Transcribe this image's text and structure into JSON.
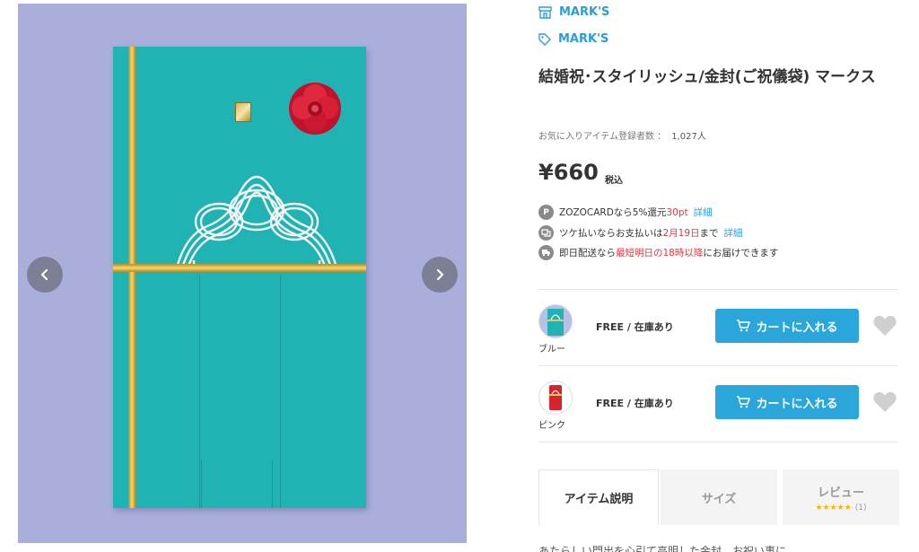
{
  "brand": {
    "shop_name": "MARK'S",
    "brand_name": "MARK'S"
  },
  "product": {
    "title": "結婚祝･スタイリッシュ/金封(ご祝儀袋) マークス",
    "favorite_label": "お気に入りアイテム登録者数 ：",
    "favorite_count": "1,027人",
    "price": "¥660",
    "tax_label": "税込"
  },
  "benefits": {
    "zozocard_prefix": "ZOZOCARDなら5%還元",
    "zozocard_points": "30pt",
    "zozocard_link": "詳細",
    "tsuke_prefix": "ツケ払いならお支払いは",
    "tsuke_date": "2月19日",
    "tsuke_suffix": "まで",
    "tsuke_link": "詳細",
    "delivery_prefix": "即日配送なら",
    "delivery_highlight": "最短明日の18時以降",
    "delivery_suffix": "にお届けできます"
  },
  "variants": [
    {
      "color": "ブルー",
      "stock": "FREE / 在庫あり",
      "cart_label": "カートに入れる",
      "swatch_color": "#1fb3b4"
    },
    {
      "color": "ピンク",
      "stock": "FREE / 在庫あり",
      "cart_label": "カートに入れる",
      "swatch_color": "#d8232e"
    }
  ],
  "tabs": {
    "description": "アイテム説明",
    "size": "サイズ",
    "review": "レビュー",
    "review_stars": "★★★★★",
    "review_count": "(1)"
  },
  "truncated_text": "あたらしい門出を心引て高明した金封。お祝い事に。",
  "colors": {
    "accent": "#2a9fd6",
    "cart": "#2ba6db",
    "highlight": "#e0363c",
    "image_bg": "#a9aedb"
  }
}
